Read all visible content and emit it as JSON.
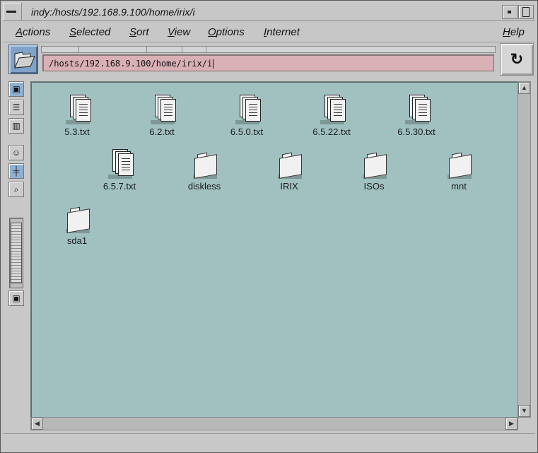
{
  "window": {
    "title": "indy:/hosts/192.168.9.100/home/irix/i"
  },
  "menu": [
    "Actions",
    "Selected",
    "Sort",
    "View",
    "Options",
    "Internet",
    "Help"
  ],
  "location": {
    "path": "/hosts/192.168.9.100/home/irix/i"
  },
  "items": [
    {
      "name": "5.3.txt",
      "type": "file"
    },
    {
      "name": "6.2.txt",
      "type": "file"
    },
    {
      "name": "6.5.0.txt",
      "type": "file"
    },
    {
      "name": "6.5.22.txt",
      "type": "file"
    },
    {
      "name": "6.5.30.txt",
      "type": "file"
    },
    {
      "name": "6.5.7.txt",
      "type": "file"
    },
    {
      "name": "diskless",
      "type": "folder"
    },
    {
      "name": "IRIX",
      "type": "folder"
    },
    {
      "name": "ISOs",
      "type": "folder"
    },
    {
      "name": "mnt",
      "type": "folder"
    },
    {
      "name": "sda1",
      "type": "folder"
    }
  ],
  "colors": {
    "viewer_bg": "#a1c1c1",
    "path_field_bg": "#d9b0b6",
    "folder_button": "#7fa2c9"
  }
}
